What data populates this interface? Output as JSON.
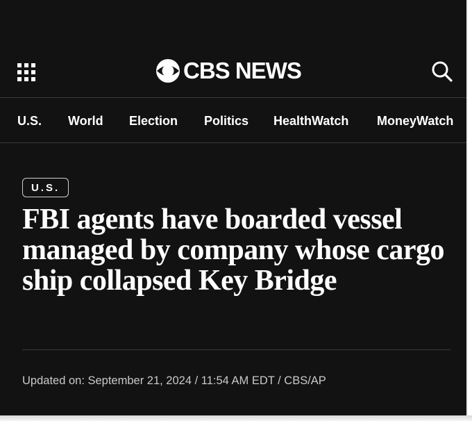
{
  "header": {
    "logo_text": "CBS NEWS",
    "menu_icon": "grid-menu-icon",
    "search_icon": "search-icon",
    "logo_icon": "cbs-eye-icon"
  },
  "nav": {
    "items": [
      {
        "label": "U.S."
      },
      {
        "label": "World"
      },
      {
        "label": "Election"
      },
      {
        "label": "Politics"
      },
      {
        "label": "HealthWatch"
      },
      {
        "label": "MoneyWatch"
      }
    ]
  },
  "article": {
    "section_tag": "U.S.",
    "headline": "FBI agents have boarded vessel managed by company whose cargo ship collapsed Key Bridge",
    "meta": "Updated on: September 21, 2024 / 11:54 AM EDT / CBS/AP"
  },
  "colors": {
    "background": "#121212",
    "text": "#ffffff",
    "meta_text": "#c9c9c9",
    "divider": "#3a3a3a"
  }
}
